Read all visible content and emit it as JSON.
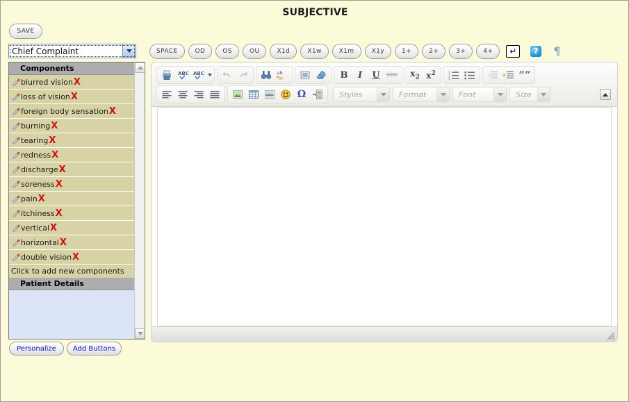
{
  "page": {
    "title": "SUBJECTIVE",
    "background_color": "#fcfbd9"
  },
  "toolbar": {
    "save_label": "SAVE"
  },
  "complaint_select": {
    "value": "Chief Complaint",
    "arrow_icon": "chevron-down-icon"
  },
  "left_panel": {
    "components_header": "Components",
    "items": [
      {
        "label": "blurred vision",
        "edit_icon": "pencil-icon",
        "delete_icon": "close-x-icon",
        "delete_label": "X"
      },
      {
        "label": "loss of vision",
        "edit_icon": "pencil-icon",
        "delete_icon": "close-x-icon",
        "delete_label": "X"
      },
      {
        "label": "foreign body sensation",
        "edit_icon": "pencil-icon",
        "delete_icon": "close-x-icon",
        "delete_label": "X"
      },
      {
        "label": "burning",
        "edit_icon": "pencil-icon",
        "delete_icon": "close-x-icon",
        "delete_label": "X"
      },
      {
        "label": "tearing",
        "edit_icon": "pencil-icon",
        "delete_icon": "close-x-icon",
        "delete_label": "X"
      },
      {
        "label": "redness",
        "edit_icon": "pencil-icon",
        "delete_icon": "close-x-icon",
        "delete_label": "X"
      },
      {
        "label": "discharge",
        "edit_icon": "pencil-icon",
        "delete_icon": "close-x-icon",
        "delete_label": "X"
      },
      {
        "label": "soreness",
        "edit_icon": "pencil-icon",
        "delete_icon": "close-x-icon",
        "delete_label": "X"
      },
      {
        "label": "pain",
        "edit_icon": "pencil-icon",
        "delete_icon": "close-x-icon",
        "delete_label": "X"
      },
      {
        "label": "itchiness",
        "edit_icon": "pencil-icon",
        "delete_icon": "close-x-icon",
        "delete_label": "X"
      },
      {
        "label": "vertical",
        "edit_icon": "pencil-icon",
        "delete_icon": "close-x-icon",
        "delete_label": "X"
      },
      {
        "label": "horizontal",
        "edit_icon": "pencil-icon",
        "delete_icon": "close-x-icon",
        "delete_label": "X"
      },
      {
        "label": "double vision",
        "edit_icon": "pencil-icon",
        "delete_icon": "close-x-icon",
        "delete_label": "X"
      }
    ],
    "add_new_label": "Click to add new components",
    "patient_details_header": "Patient Details",
    "row_color": "#d8d3a6",
    "header_color": "#adadad",
    "patient_details_color": "#dbe5f7"
  },
  "bottom_buttons": {
    "personalize": "Personalize",
    "add_buttons": "Add Buttons",
    "text_color": "#0a14c8"
  },
  "quickbar": {
    "buttons": [
      "SPACE",
      "OD",
      "OS",
      "OU",
      "X1d",
      "X1w",
      "X1m",
      "X1y",
      "1+",
      "2+",
      "3+",
      "4+"
    ],
    "enter_icon": "enter-return-icon",
    "enter_glyph": "↵",
    "help_icon": "help-question-icon",
    "help_glyph": "?",
    "pilcrow_icon": "pilcrow-icon",
    "pilcrow_glyph": "¶"
  },
  "editor": {
    "toolbar_row1": [
      {
        "group": 1,
        "name": "print-icon"
      },
      {
        "group": 1,
        "name": "spellcheck-icon"
      },
      {
        "group": 1,
        "name": "spellcheck-menu-icon"
      },
      {
        "group": 2,
        "name": "undo-icon"
      },
      {
        "group": 2,
        "name": "redo-icon"
      },
      {
        "group": 3,
        "name": "find-icon"
      },
      {
        "group": 3,
        "name": "replace-icon"
      },
      {
        "group": 4,
        "name": "select-all-icon"
      },
      {
        "group": 4,
        "name": "remove-format-eraser-icon"
      },
      {
        "group": 5,
        "name": "bold-icon",
        "glyph": "B"
      },
      {
        "group": 5,
        "name": "italic-icon",
        "glyph": "I"
      },
      {
        "group": 5,
        "name": "underline-icon",
        "glyph": "U"
      },
      {
        "group": 5,
        "name": "strikethrough-icon",
        "glyph": "abc"
      },
      {
        "group": 6,
        "name": "subscript-icon",
        "glyph": "x₂"
      },
      {
        "group": 6,
        "name": "superscript-icon",
        "glyph": "x²"
      },
      {
        "group": 7,
        "name": "numbered-list-icon"
      },
      {
        "group": 7,
        "name": "bulleted-list-icon"
      },
      {
        "group": 8,
        "name": "decrease-indent-icon"
      },
      {
        "group": 8,
        "name": "increase-indent-icon"
      },
      {
        "group": 8,
        "name": "blockquote-icon",
        "glyph": "””"
      }
    ],
    "toolbar_row2": [
      {
        "group": 1,
        "name": "align-left-icon"
      },
      {
        "group": 1,
        "name": "align-center-icon"
      },
      {
        "group": 1,
        "name": "align-right-icon"
      },
      {
        "group": 1,
        "name": "align-justify-icon"
      },
      {
        "group": 2,
        "name": "insert-image-icon"
      },
      {
        "group": 2,
        "name": "insert-table-icon"
      },
      {
        "group": 2,
        "name": "horizontal-rule-icon"
      },
      {
        "group": 2,
        "name": "smiley-icon"
      },
      {
        "group": 2,
        "name": "special-character-omega-icon",
        "glyph": "Ω"
      },
      {
        "group": 2,
        "name": "page-break-icon"
      }
    ],
    "combos": [
      {
        "name": "styles-combo",
        "label": "Styles"
      },
      {
        "name": "format-combo",
        "label": "Format"
      },
      {
        "name": "font-combo",
        "label": "Font"
      },
      {
        "name": "size-combo",
        "label": "Size"
      }
    ],
    "content": "",
    "collapse_icon": "collapse-toolbar-icon",
    "resize_icon": "resize-grip-icon"
  }
}
